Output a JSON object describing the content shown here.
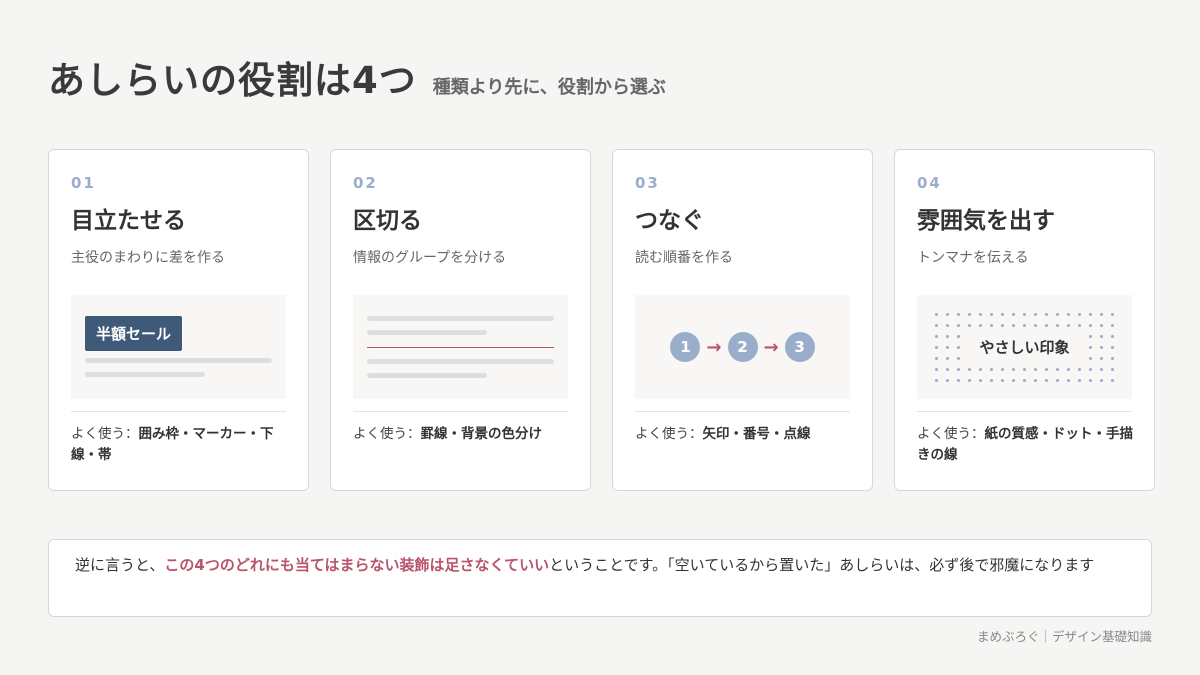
{
  "header": {
    "title": "あしらいの役割は4つ",
    "subtitle": "種類より先に、役割から選ぶ"
  },
  "cards": [
    {
      "num": "01",
      "title": "目立たせる",
      "desc": "主役のまわりに差を作る",
      "usage_prefix": "よく使う：",
      "usage": "囲み枠・マーカー・下線・帯",
      "illustration": {
        "badge": "半額セール"
      }
    },
    {
      "num": "02",
      "title": "区切る",
      "desc": "情報のグループを分ける",
      "usage_prefix": "よく使う：",
      "usage": "罫線・背景の色分け"
    },
    {
      "num": "03",
      "title": "つなぐ",
      "desc": "読む順番を作る",
      "usage_prefix": "よく使う：",
      "usage": "矢印・番号・点線",
      "illustration": {
        "steps": [
          "1",
          "2",
          "3"
        ],
        "arrow": "→"
      }
    },
    {
      "num": "04",
      "title": "雰囲気を出す",
      "desc": "トンマナを伝える",
      "usage_prefix": "よく使う：",
      "usage": "紙の質感・ドット・手描きの線",
      "illustration": {
        "label": "やさしい印象"
      }
    }
  ],
  "note": {
    "before": "逆に言うと、",
    "highlight": "この4つのどれにも当てはまらない装飾は足さなくていい",
    "after": "ということです。「空いているから置いた」あしらいは、必ず後で邪魔になります"
  },
  "footer": "まめぶろぐ｜デザイン基礎知識",
  "colors": {
    "accent_red": "#b9546c",
    "accent_blue": "#9aaecb",
    "badge_navy": "#3e5a78"
  }
}
